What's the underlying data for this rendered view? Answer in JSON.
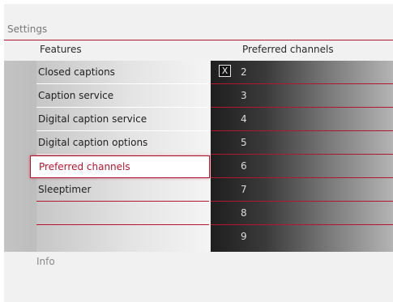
{
  "title": "Settings",
  "headers": {
    "features": "Features",
    "channels": "Preferred channels"
  },
  "features": [
    {
      "label": "Closed captions"
    },
    {
      "label": "Caption service"
    },
    {
      "label": "Digital caption service"
    },
    {
      "label": "Digital caption options"
    },
    {
      "label": "Preferred channels",
      "selected": true
    },
    {
      "label": "Sleeptimer"
    },
    {
      "label": ""
    },
    {
      "label": ""
    }
  ],
  "channels": [
    {
      "number": "2",
      "checked": true,
      "check_mark": "X"
    },
    {
      "number": "3"
    },
    {
      "number": "4"
    },
    {
      "number": "5"
    },
    {
      "number": "6"
    },
    {
      "number": "7"
    },
    {
      "number": "8"
    },
    {
      "number": "9"
    }
  ],
  "info": "Info",
  "colors": {
    "accent": "#b2172f",
    "background": "#f1f1f1",
    "channel_panel_dark": "#1e1e1e"
  }
}
